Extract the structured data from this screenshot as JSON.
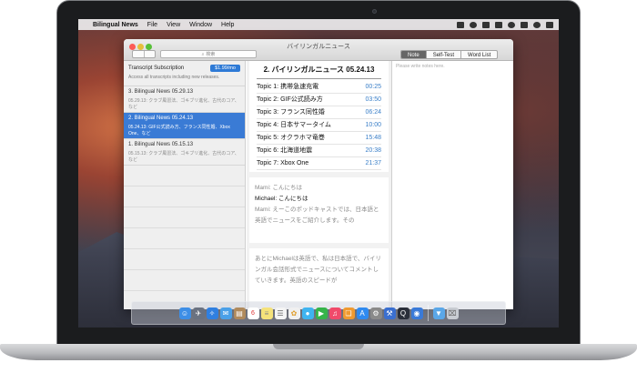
{
  "menubar": {
    "app_name": "Bilingual News",
    "items": [
      "File",
      "View",
      "Window",
      "Help"
    ]
  },
  "window": {
    "title": "バイリンガルニュース",
    "search_placeholder": "検索",
    "segments": [
      "Note",
      "Self-Test",
      "Word List"
    ],
    "active_segment": "Note"
  },
  "sidebar": {
    "subscription": {
      "title": "Transcript Subscription",
      "price": "$1.99/mo",
      "description": "Access all transcripts including new releases."
    },
    "episodes": [
      {
        "title": "3. Bilingual News 05.29.13",
        "desc": "05.29.13: クラブ風習法、ゴキブリ進化、古代のコア、など"
      },
      {
        "title": "2. Bilingual News 05.24.13",
        "desc": "05.24.13: GIF公式読み方、フランス同性婚、Xbox One、など"
      },
      {
        "title": "1. Bilingual News 05.15.13",
        "desc": "05.15.13: クラブ風習法、ゴキブリ進化、古代のコア、など"
      }
    ],
    "selected_index": 1
  },
  "episode": {
    "heading": "2. バイリンガルニュース 05.24.13",
    "topics": [
      {
        "title": "Topic 1: 携帯急速充電",
        "time": "00:25"
      },
      {
        "title": "Topic 2: GIF公式読み方",
        "time": "03:50"
      },
      {
        "title": "Topic 3: フランス同性婚",
        "time": "06:24"
      },
      {
        "title": "Topic 4: 日本サマータイム",
        "time": "10:00"
      },
      {
        "title": "Topic 5: オクラホマ竜巻",
        "time": "15:48"
      },
      {
        "title": "Topic 6: 北海道地震",
        "time": "20:38"
      },
      {
        "title": "Topic 7: Xbox One",
        "time": "21:37"
      }
    ],
    "transcript": {
      "line1": "Mami: こんにちは",
      "line2": "Michael: こんにちは",
      "line3": "Mami: えーこのポッドキャストでは、日本語と英語でニュースをご紹介します。その",
      "para2": "あとにMichaelは英語で、私は日本語で、バイリンガル会話形式でニュースについてコメントしていきます。英語のスピードが"
    }
  },
  "notes": {
    "placeholder": "Please write notes here."
  },
  "dock": {
    "icons": [
      "finder-icon",
      "launchpad-icon",
      "safari-icon",
      "mail-icon",
      "contacts-icon",
      "calendar-icon",
      "notes-icon",
      "reminders-icon",
      "photos-icon",
      "messages-icon",
      "facetime-icon",
      "music-icon",
      "books-icon",
      "appstore-icon",
      "preferences-icon",
      "xcode-icon",
      "quicktime-icon",
      "network-icon",
      "downloads-icon",
      "trash-icon"
    ],
    "calendar_day": "6"
  }
}
